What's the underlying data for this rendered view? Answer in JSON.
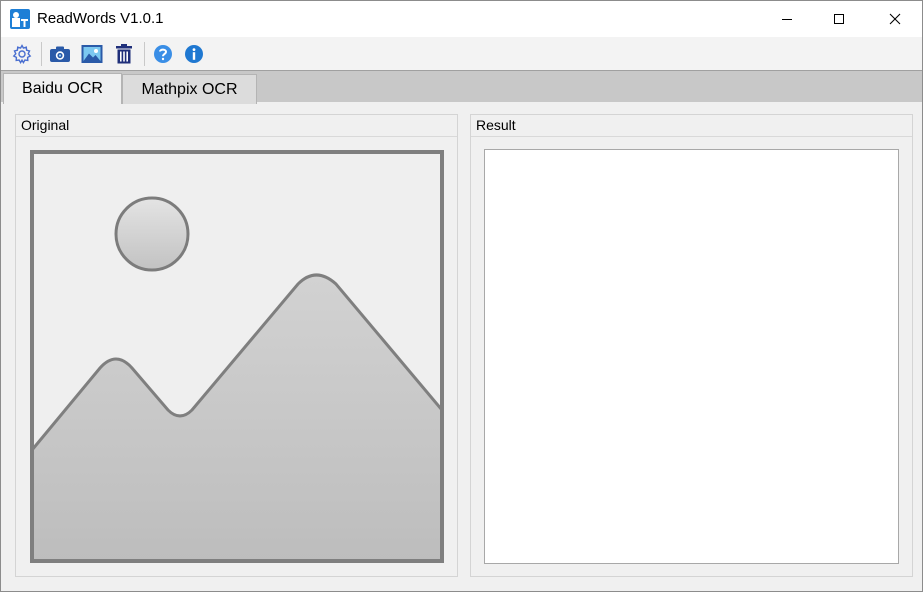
{
  "window": {
    "title": "ReadWords V1.0.1"
  },
  "icons": {
    "app": "app-icon",
    "minimize": "minimize-icon",
    "maximize": "maximize-icon",
    "close": "close-icon",
    "settings": "gear-icon",
    "screenshot": "camera-icon",
    "open_image": "image-icon",
    "delete": "trash-icon",
    "help": "help-icon",
    "about": "info-icon"
  },
  "tabs": [
    {
      "label": "Baidu OCR",
      "active": true
    },
    {
      "label": "Mathpix OCR",
      "active": false
    }
  ],
  "panels": {
    "original": {
      "label": "Original"
    },
    "result": {
      "label": "Result",
      "text": ""
    }
  },
  "colors": {
    "toolbar_icon_blue": "#2a5aa8",
    "help_blue": "#3a8ee6",
    "placeholder_gray": "#c4c4c4"
  }
}
